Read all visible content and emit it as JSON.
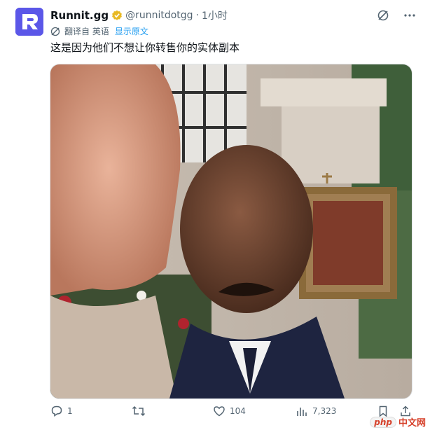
{
  "tweet": {
    "name": "Runnit.gg",
    "handle": "@runnitdotgg",
    "separator": "·",
    "time": "1小时",
    "translated_label": "翻译自 英语",
    "show_original": "显示原文",
    "text": "这是因为他们不想让你转售你的实体副本",
    "avatar_letter": "R",
    "colors": {
      "avatar_bg": "#5b57e8",
      "link": "#1d9bf0",
      "verified": "#e8b923",
      "muted": "#536471"
    }
  },
  "media": {
    "type": "photo",
    "alt_description": "film still: two men close up, one in foreground left, another with moustache in suit, religious painting in background"
  },
  "actions": {
    "reply_count": "1",
    "retweet_count": "",
    "like_count": "104",
    "views_count": "7,323"
  },
  "watermark": {
    "php": "php",
    "cn": "中文网"
  }
}
